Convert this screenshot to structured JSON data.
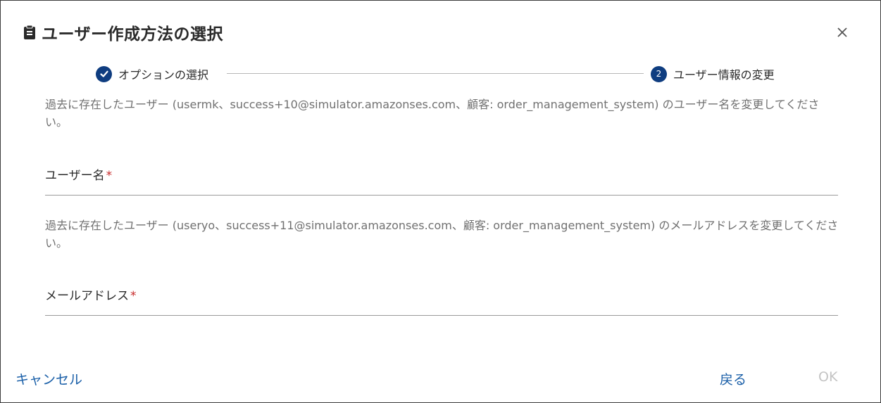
{
  "dialog": {
    "title": "ユーザー作成方法の選択",
    "icons": {
      "title": "clipboard-icon",
      "close": "close-icon",
      "step_done": "check-icon"
    },
    "colors": {
      "accent": "#0f3d80",
      "link": "#1a5fa8",
      "required": "#c62828",
      "disabled": "#c4c4c4"
    }
  },
  "stepper": {
    "steps": [
      {
        "label": "オプションの選択",
        "status": "completed"
      },
      {
        "number": "2",
        "label": "ユーザー情報の変更",
        "status": "current"
      }
    ]
  },
  "form": {
    "username_description": "過去に存在したユーザー (usermk、success+10@simulator.amazonses.com、顧客: order_management_system) のユーザー名を変更してください。",
    "username_label": "ユーザー名",
    "username_value": "",
    "email_description": "過去に存在したユーザー (useryo、success+11@simulator.amazonses.com、顧客: order_management_system) のメールアドレスを変更してください。",
    "email_label": "メールアドレス",
    "email_value": "",
    "required_mark": "*"
  },
  "footer": {
    "cancel_label": "キャンセル",
    "back_label": "戻る",
    "ok_label": "OK"
  }
}
